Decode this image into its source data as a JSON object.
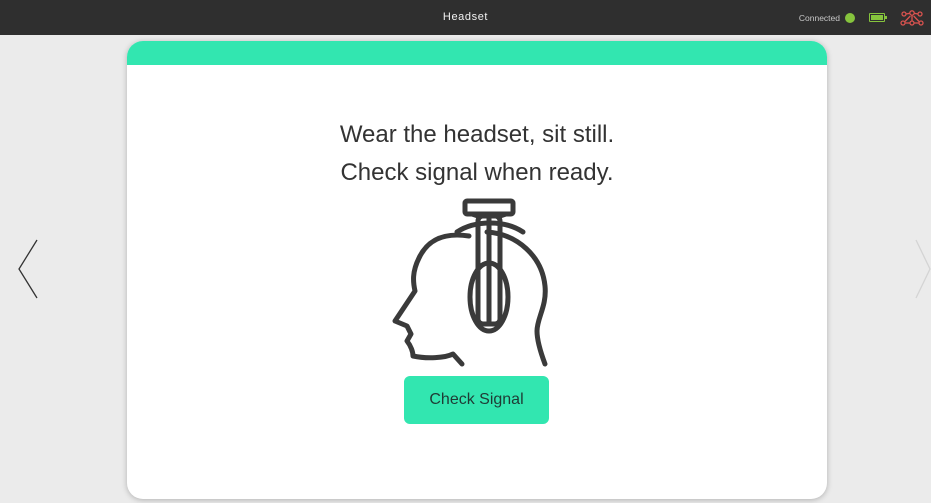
{
  "header": {
    "title": "Headset",
    "connection_status": "Connected",
    "connection_color": "#86c43d",
    "battery_color": "#86c43d",
    "icons": [
      "status-dot",
      "battery-icon",
      "network-icon"
    ]
  },
  "card": {
    "accent_color": "#32e6b0",
    "message_line_1": "Wear the headset, sit still.",
    "message_line_2": "Check signal when ready.",
    "illustration": "head-with-headset-icon",
    "button_label": "Check Signal",
    "button_color": "#32e6b0"
  },
  "navigation": {
    "previous_icon": "chevron-left-icon",
    "next_icon": "chevron-right-icon"
  }
}
